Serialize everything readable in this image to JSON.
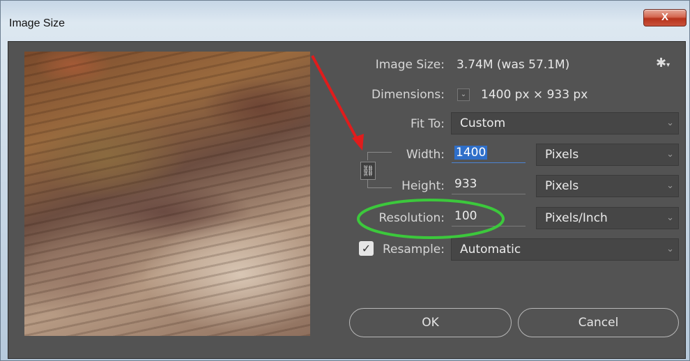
{
  "window": {
    "title": "Image Size",
    "close_label": "X"
  },
  "info": {
    "image_size_label": "Image Size:",
    "image_size_value": "3.74M (was 57.1M)",
    "dimensions_label": "Dimensions:",
    "dimensions_toggle": "⌄",
    "dimensions_value": "1400 px  ×  933 px"
  },
  "fit_to": {
    "label": "Fit To:",
    "value": "Custom"
  },
  "width": {
    "label": "Width:",
    "value": "1400",
    "unit": "Pixels"
  },
  "height": {
    "label": "Height:",
    "value": "933",
    "unit": "Pixels"
  },
  "resolution": {
    "label": "Resolution:",
    "value": "100",
    "unit": "Pixels/Inch"
  },
  "resample": {
    "label": "Resample:",
    "checked": true,
    "value": "Automatic"
  },
  "buttons": {
    "ok": "OK",
    "cancel": "Cancel"
  },
  "icons": {
    "gear": "gear-icon",
    "link": "link-chain-icon",
    "checkmark": "checkmark-icon",
    "chevron": "chevron-down-icon"
  },
  "colors": {
    "dialog_bg": "#535353",
    "selection": "#2f6fc9",
    "annotation_arrow": "#e01c1c",
    "annotation_ellipse": "#3cc83c",
    "close_button": "#c9523a"
  }
}
